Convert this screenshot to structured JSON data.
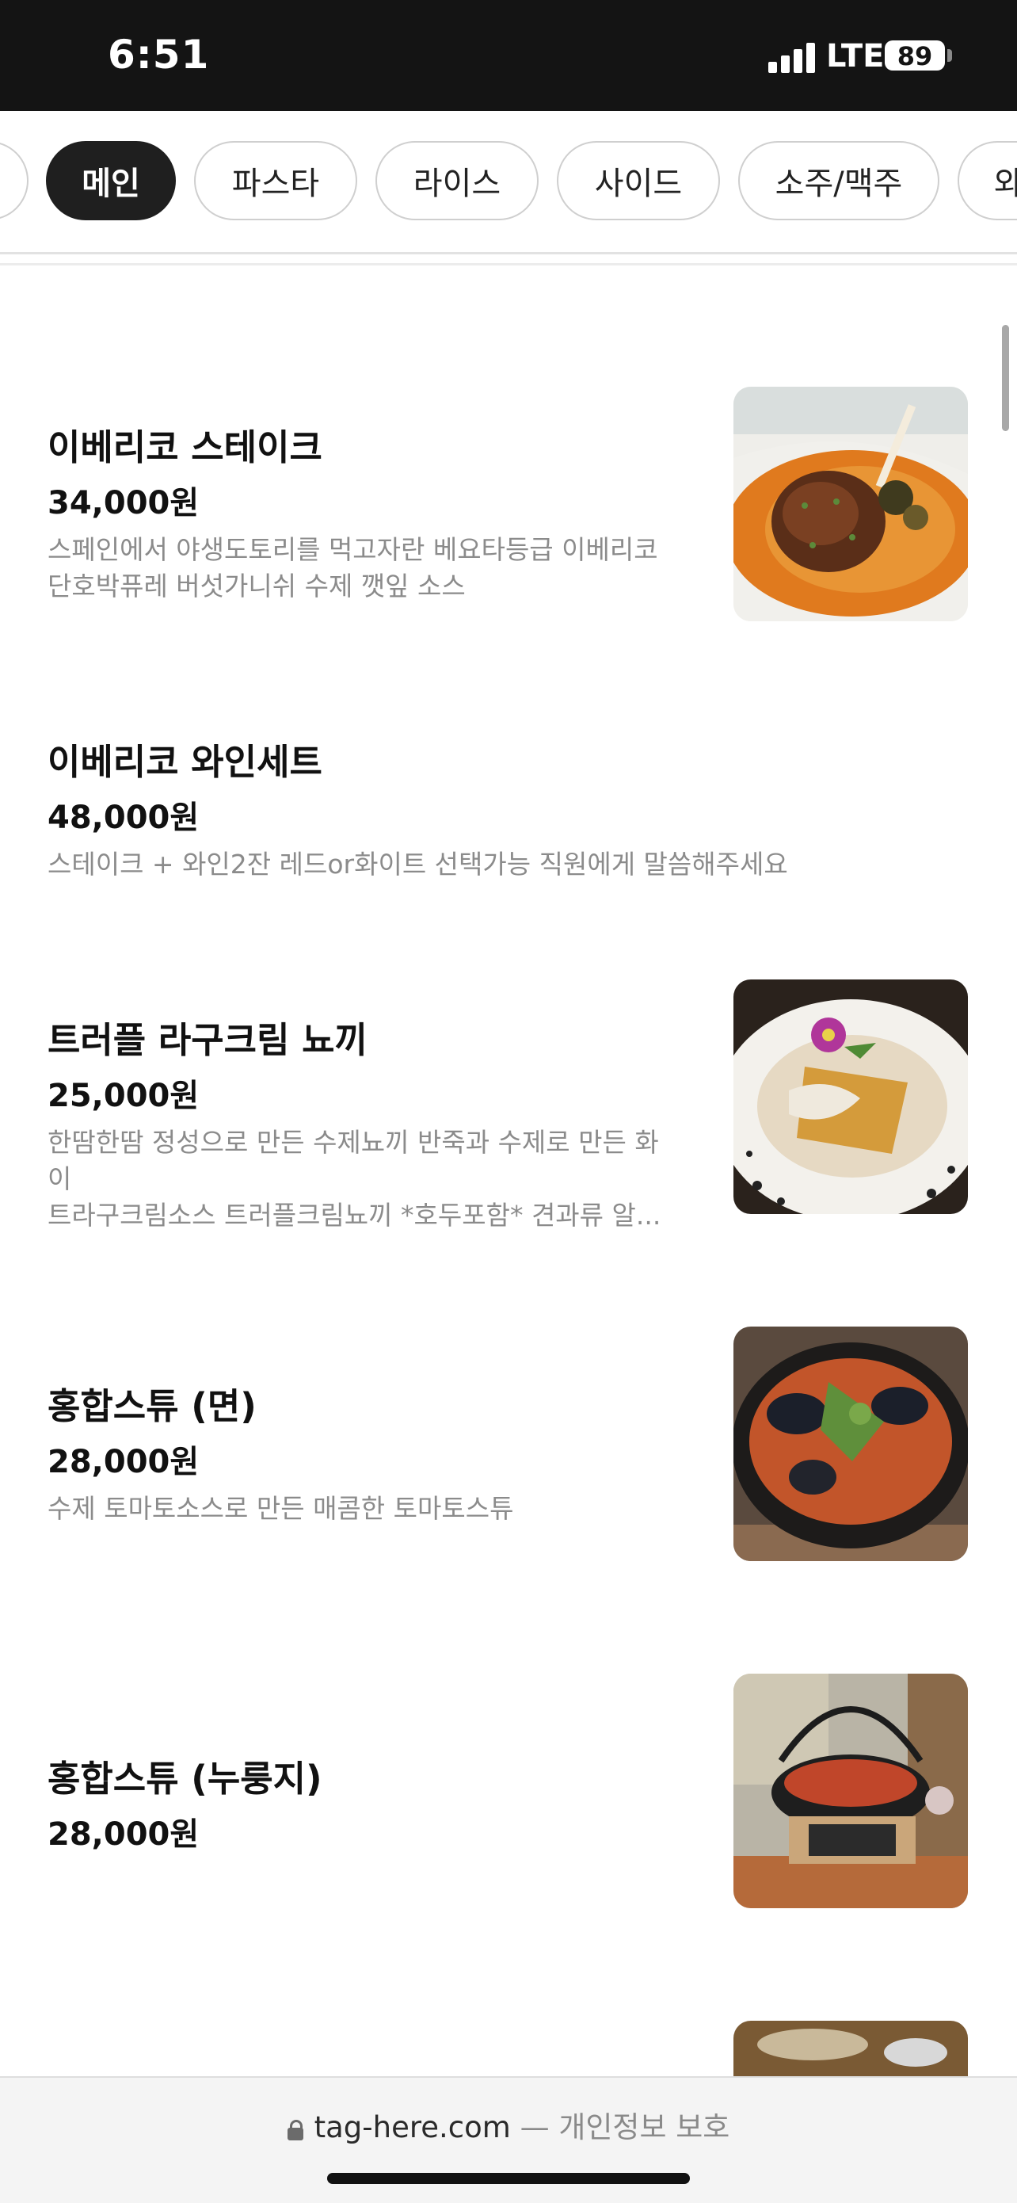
{
  "status_bar": {
    "time": "6:51",
    "network": "LTE",
    "battery": "89"
  },
  "tabs": [
    {
      "label": "메인",
      "active": true
    },
    {
      "label": "파스타",
      "active": false
    },
    {
      "label": "라이스",
      "active": false
    },
    {
      "label": "사이드",
      "active": false
    },
    {
      "label": "소주/맥주",
      "active": false
    },
    {
      "label": "와",
      "active": false
    }
  ],
  "menu": [
    {
      "title": "이베리코 스테이크",
      "price": "34,000원",
      "desc_line1": "스페인에서 야생도토리를 먹고자란 베요타등급 이베리코",
      "desc_line2": "단호박퓨레 버섯가니쉬 수제 깻잎 소스"
    },
    {
      "title": "이베리코 와인세트",
      "price": "48,000원",
      "desc_line1": "스테이크 + 와인2잔 레드or화이트 선택가능 직원에게 말씀해주세요"
    },
    {
      "title": "트러플 라구크림 뇨끼",
      "price": "25,000원",
      "desc_line1": "한땀한땀 정성으로 만든 수제뇨끼 반죽과 수제로 만든 화이",
      "desc_line2": "트라구크림소스 트러플크림뇨끼 *호두포함* 견과류 알..."
    },
    {
      "title": "홍합스튜 (면)",
      "price": "28,000원",
      "desc_line1": "수제 토마토소스로 만든 매콤한 토마토스튜"
    },
    {
      "title": "홍합스튜 (누룽지)",
      "price": "28,000원"
    }
  ],
  "bottom_bar": {
    "domain": "tag-here.com",
    "separator": " — ",
    "privacy": "개인정보 보호"
  },
  "colors": {
    "status_bar_bg": "#141414",
    "active_tab_bg": "#1f1f1f",
    "desc_text": "#8b8b8b"
  }
}
